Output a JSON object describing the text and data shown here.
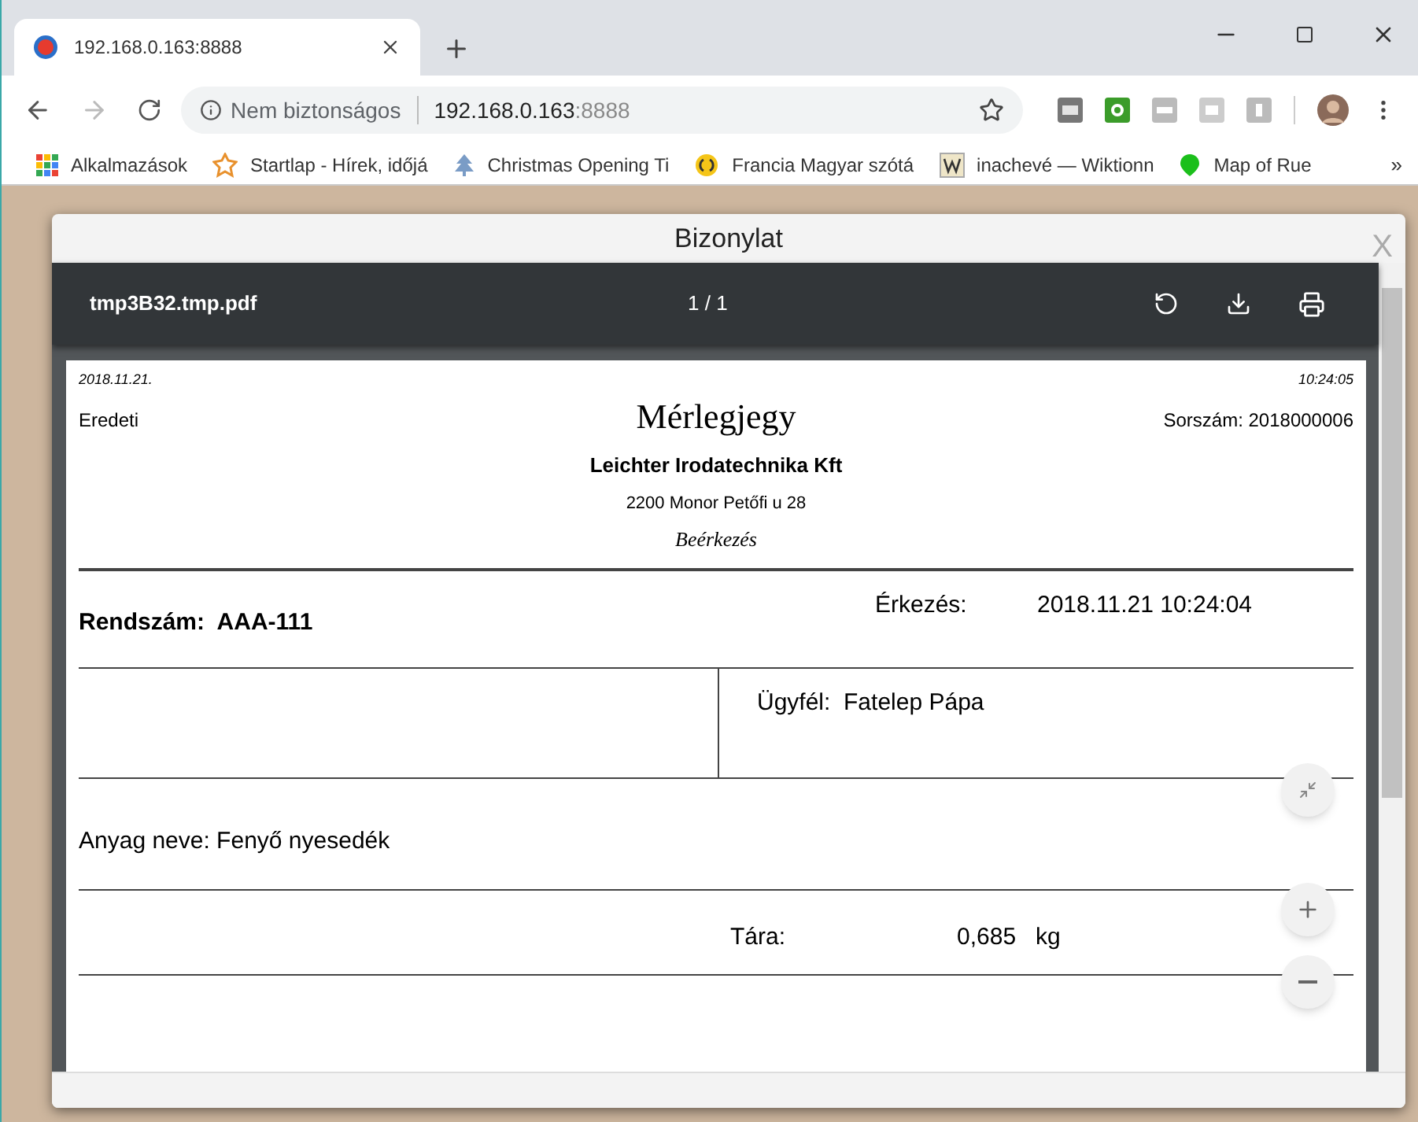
{
  "browser": {
    "tab": {
      "title": "192.168.0.163:8888"
    },
    "address": {
      "security": "Nem biztonságos",
      "host": "192.168.0.163",
      "port": ":8888"
    },
    "bookmarks": [
      {
        "label": "Alkalmazások",
        "kind": "apps"
      },
      {
        "label": "Startlap - Hírek, időjá",
        "kind": "star"
      },
      {
        "label": "Christmas Opening Ti",
        "kind": "tree"
      },
      {
        "label": "Francia Magyar szótá",
        "kind": "coin"
      },
      {
        "label": "inachevé — Wiktionn",
        "kind": "wiki"
      },
      {
        "label": "Map of Rue",
        "kind": "map"
      }
    ],
    "more": "»"
  },
  "dialog": {
    "title": "Bizonylat",
    "close": "X",
    "pdf": {
      "filename": "tmp3B32.tmp.pdf",
      "page": "1 / 1"
    },
    "document": {
      "date": "2018.11.21.",
      "time": "10:24:05",
      "copy": "Eredeti",
      "title": "Mérlegjegy",
      "serial": "Sorszám: 2018000006",
      "company": "Leichter Irodatechnika Kft",
      "address": "2200 Monor Petőfi u 28",
      "direction": "Beérkezés",
      "plate_label": "Rendszám:",
      "plate": "AAA-111",
      "arrival_label": "Érkezés:",
      "arrival": "2018.11.21 10:24:04",
      "customer_label": "Ügyfél:",
      "customer": "Fatelep Pápa",
      "material_label": "Anyag neve:",
      "material": "Fenyő nyesedék",
      "tare_label": "Tára:",
      "tare": "0,685",
      "tare_unit": "kg"
    }
  }
}
